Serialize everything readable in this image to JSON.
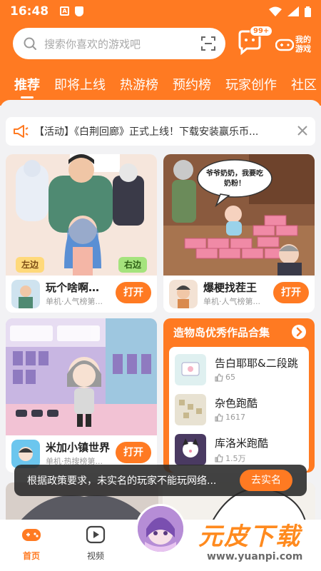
{
  "status_bar": {
    "time": "16:48",
    "icon_a": "A"
  },
  "search": {
    "placeholder": "搜索你喜欢的游戏吧"
  },
  "header": {
    "message_badge": "99+",
    "my_games_label": "我的游戏"
  },
  "tabs": [
    "推荐",
    "即将上线",
    "热游榜",
    "预约榜",
    "玩家创作",
    "社区"
  ],
  "notice": {
    "text": "【活动】《白荆回廊》正式上线！下载安装赢乐币..."
  },
  "cards": [
    {
      "title": "玩个啥啊（...",
      "subtitle": "单机·人气榜第...",
      "button": "打开",
      "tag_left": "左边",
      "tag_right": "右边"
    },
    {
      "title": "爆梗找茬王",
      "subtitle": "单机·人气榜第...",
      "button": "打开",
      "speech": "爷爷奶奶，我要吃奶粉！"
    },
    {
      "title": "米加小镇世界",
      "subtitle": "单机·热搜榜第...",
      "button": "打开"
    }
  ],
  "collection": {
    "title": "造物岛优秀作品合集",
    "items": [
      {
        "name": "告白耶耶&二段跳",
        "likes": "65"
      },
      {
        "name": "杂色跑酷",
        "likes": "1617"
      },
      {
        "name": "库洛米跑酷",
        "likes": "1.5万"
      }
    ]
  },
  "toast": {
    "text": "根据政策要求，未实名的玩家不能玩网络...",
    "button": "去实名"
  },
  "bottom_nav": [
    {
      "label": "首页",
      "icon": "gamepad-icon"
    },
    {
      "label": "视频",
      "icon": "play-icon"
    }
  ],
  "watermark": {
    "main": "元皮下载",
    "sub": "www.yuanpi.com"
  },
  "colors": {
    "accent": "#ff7a22",
    "background": "#f2f2f4"
  }
}
